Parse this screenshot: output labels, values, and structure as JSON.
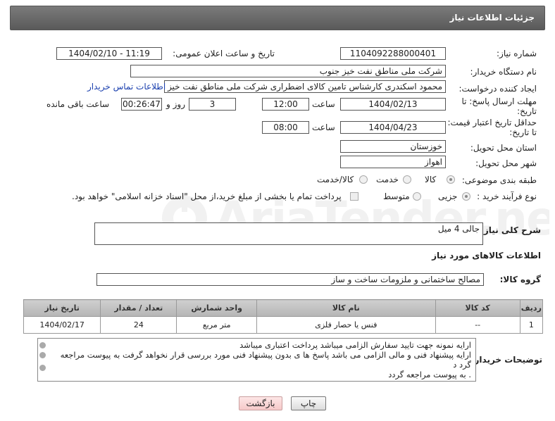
{
  "header": {
    "title": "جزئیات اطلاعات نیاز"
  },
  "form": {
    "need_number_label": "شماره نیاز:",
    "need_number": "1104092288000401",
    "announce_label": "تاریخ و ساعت اعلان عمومی:",
    "announce_value": "1404/02/10 - 11:19",
    "buyer_org_label": "نام دستگاه خریدار:",
    "buyer_org": "شرکت ملی مناطق نفت خیز جنوب",
    "creator_label": "ایجاد کننده درخواست:",
    "creator": "محمود  اسکندری کارشناس تامین کالای اضطراری شرکت ملی مناطق نفت خیز",
    "contact_link": "اطلاعات تماس خریدار",
    "deadline_label_1": "مهلت ارسال پاسخ: تا",
    "deadline_label_2": "تاریخ:",
    "deadline_date": "1404/02/13",
    "time_label": "ساعت",
    "deadline_time": "12:00",
    "days": "3",
    "days_label": "روز و",
    "remaining": "00:26:47",
    "remaining_label": "ساعت باقی مانده",
    "validity_label_1": "حداقل تاریخ اعتبار قیمت:",
    "validity_label_2": "تا تاریخ:",
    "validity_date": "1404/04/23",
    "validity_time_label": "ساعت",
    "validity_time": "08:00",
    "province_label": "استان محل تحویل:",
    "province": "خوزستان",
    "city_label": "شهر محل تحویل:",
    "city": "اهواز",
    "category_label": "طبقه بندی موضوعی:",
    "category_options": [
      "کالا",
      "خدمت",
      "کالا/خدمت"
    ],
    "process_label": "نوع فرآیند خرید :",
    "process_options": [
      "جزیی",
      "متوسط"
    ],
    "payment_note": "پرداخت تمام یا بخشی از مبلغ خرید،از محل \"اسناد خزانه اسلامی\" خواهد بود.",
    "summary_label": "شرح کلی نیاز:",
    "summary": "جالی 4 میل",
    "goods_info_title": "اطلاعات کالاهای مورد نیاز",
    "goods_group_label": "گروه کالا:",
    "goods_group": "مصالح ساختمانی و ملزومات ساخت و ساز"
  },
  "table": {
    "headers": [
      "ردیف",
      "کد کالا",
      "نام کالا",
      "واحد شمارش",
      "تعداد / مقدار",
      "تاریخ نیاز"
    ],
    "rows": [
      {
        "row": "1",
        "code": "--",
        "name": "فنس یا حصار فلزی",
        "unit": "متر مربع",
        "qty": "24",
        "date": "1404/02/17"
      }
    ]
  },
  "notes": {
    "label": "توضیحات خریدار:",
    "lines": [
      "ارایه نمونه جهت تایید سفارش الزامی میباشد پرداخت اعتباری میباشد",
      "ارایه پیشنهاد فنی و مالی الزامی می باشد پاسخ ها ی بدون پیشنهاد فنی مورد بررسی قرار نخواهد گرفت به پیوست مراجعه گرد د",
      ". به پیوست مراجعه گردد"
    ]
  },
  "buttons": {
    "print": "چاپ",
    "back": "بازگشت"
  },
  "watermark": {
    "text": "AriaTender.net"
  },
  "colors": {
    "header_bg": "#666666",
    "link": "#1a3fae",
    "back_button": "#f6c9c9"
  }
}
